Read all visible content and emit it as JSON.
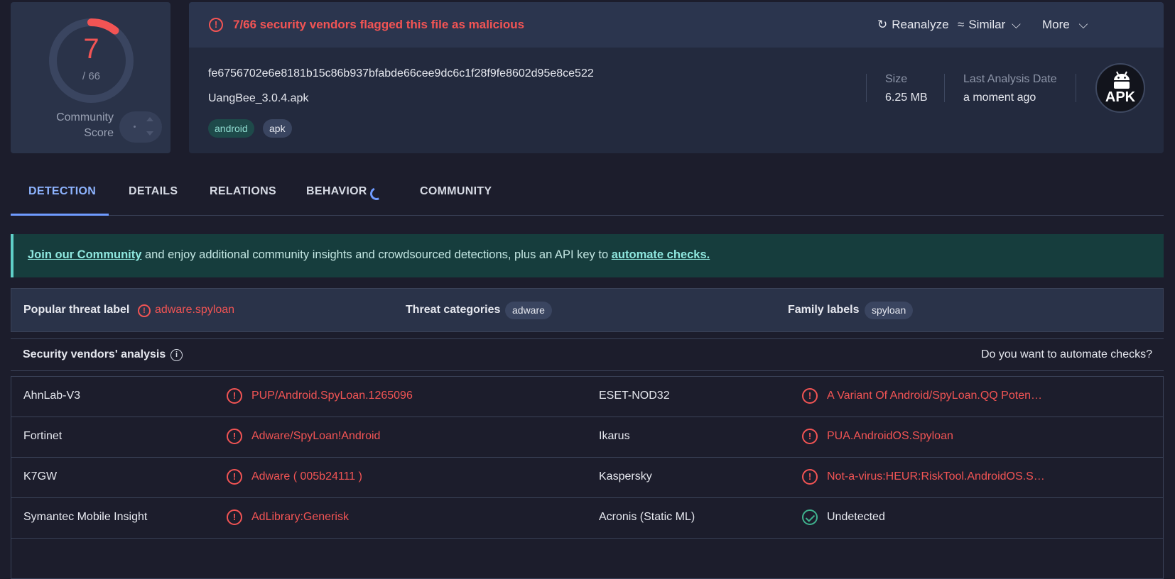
{
  "score": {
    "detections": "7",
    "total": "/ 66",
    "detection_fraction": 0.106,
    "community_label_line1": "Community",
    "community_label_line2": "Score"
  },
  "header": {
    "alert_text": "7/66 security vendors flagged this file as malicious",
    "actions": {
      "reanalyze": "Reanalyze",
      "similar": "Similar",
      "more": "More"
    },
    "hash": "fe6756702e6e8181b15c86b937bfabde66cee9dc6c1f28f9fe8602d95e8ce522",
    "filename": "UangBee_3.0.4.apk",
    "tags": [
      "android",
      "apk"
    ],
    "size_label": "Size",
    "size_value": "6.25 MB",
    "date_label": "Last Analysis Date",
    "date_value": "a moment ago",
    "file_type_badge": "APK"
  },
  "tabs": [
    "DETECTION",
    "DETAILS",
    "RELATIONS",
    "BEHAVIOR",
    "COMMUNITY"
  ],
  "banner": {
    "link1": "Join our Community",
    "middle": " and enjoy additional community insights and crowdsourced detections, plus an API key to ",
    "link2": "automate checks."
  },
  "threat": {
    "popular_label": "Popular threat label",
    "popular_value": "adware.spyloan",
    "categories_label": "Threat categories",
    "categories_value": "adware",
    "family_label": "Family labels",
    "family_value": "spyloan"
  },
  "vendors_section": {
    "title": "Security vendors' analysis",
    "right_link": "Do you want to automate checks?"
  },
  "vendors": [
    {
      "left": {
        "name": "AhnLab-V3",
        "result": "PUP/Android.SpyLoan.1265096",
        "status": "malicious"
      },
      "right": {
        "name": "ESET-NOD32",
        "result": "A Variant Of Android/SpyLoan.QQ Poten…",
        "status": "malicious"
      }
    },
    {
      "left": {
        "name": "Fortinet",
        "result": "Adware/SpyLoan!Android",
        "status": "malicious"
      },
      "right": {
        "name": "Ikarus",
        "result": "PUA.AndroidOS.Spyloan",
        "status": "malicious"
      }
    },
    {
      "left": {
        "name": "K7GW",
        "result": "Adware ( 005b24111 )",
        "status": "malicious"
      },
      "right": {
        "name": "Kaspersky",
        "result": "Not-a-virus:HEUR:RiskTool.AndroidOS.S…",
        "status": "malicious"
      }
    },
    {
      "left": {
        "name": "Symantec Mobile Insight",
        "result": "AdLibrary:Generisk",
        "status": "malicious"
      },
      "right": {
        "name": "Acronis (Static ML)",
        "result": "Undetected",
        "status": "clean"
      }
    }
  ],
  "colors": {
    "malicious": "#f25454",
    "clean": "#3fb28e",
    "accent": "#6f9bff",
    "banner_bg": "#163d3d"
  }
}
